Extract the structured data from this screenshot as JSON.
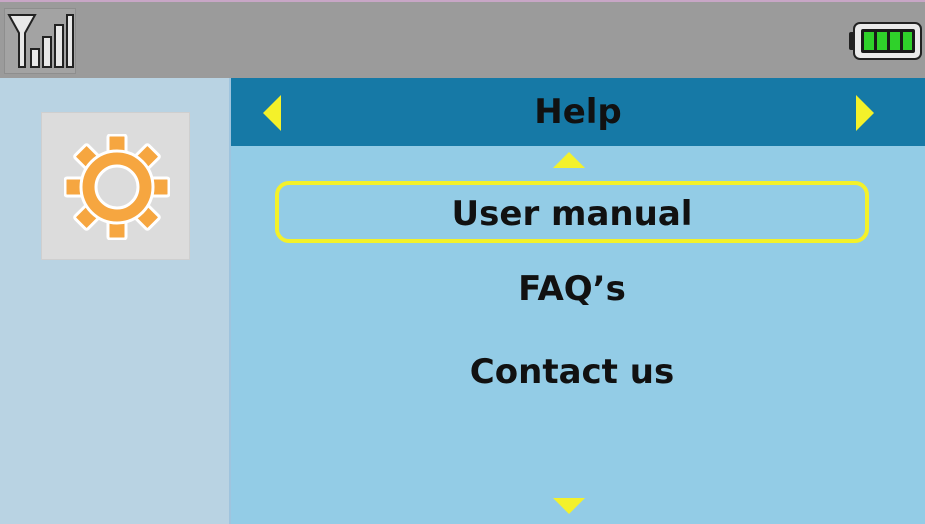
{
  "status_bar": {
    "signal_icon": "signal-strength-icon",
    "signal_bars_filled": 3,
    "battery_icon": "battery-full-icon",
    "battery_level": 1.0,
    "battery_color": "#2fd12a"
  },
  "sidebar": {
    "app_icon": "gear-icon",
    "icon_color": "#f6a640"
  },
  "header": {
    "title": "Help",
    "prev_icon": "triangle-left-icon",
    "next_icon": "triangle-right-icon",
    "accent_color": "#f4f12a",
    "background_color": "#1679a6"
  },
  "menu": {
    "scroll_up_icon": "triangle-up-icon",
    "scroll_down_icon": "triangle-down-icon",
    "selected_index": 0,
    "items": [
      {
        "label": "User manual"
      },
      {
        "label": "FAQ’s"
      },
      {
        "label": "Contact us"
      }
    ]
  }
}
